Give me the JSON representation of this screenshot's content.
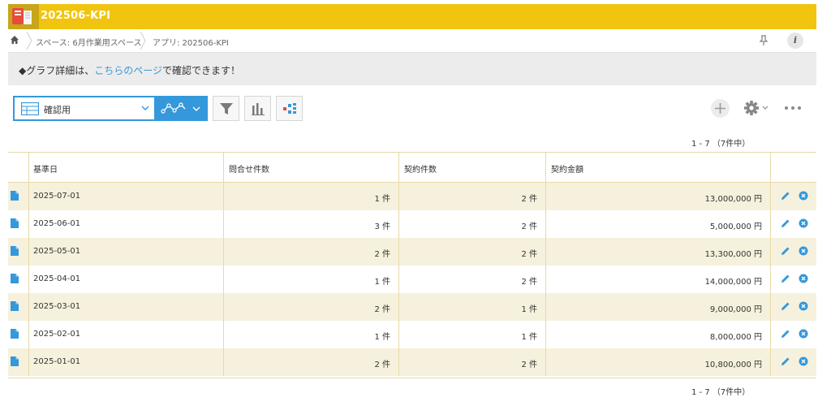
{
  "app": {
    "title": "202506-KPI"
  },
  "breadcrumb": {
    "space": "スペース: 6月作業用スペース",
    "app": "アプリ: 202506-KPI"
  },
  "notice": {
    "prefix": "◆グラフ詳細は、",
    "link": "こちらのページ",
    "suffix": "で確認できます！"
  },
  "toolbar": {
    "view_label": "確認用"
  },
  "pager": {
    "range": "1 - 7 （7件中）"
  },
  "table": {
    "headers": [
      "基準日",
      "問合せ件数",
      "契約件数",
      "契約金額"
    ],
    "rows": [
      [
        "2025-07-01",
        "1 件",
        "2 件",
        "13,000,000 円"
      ],
      [
        "2025-06-01",
        "3 件",
        "2 件",
        "5,000,000 円"
      ],
      [
        "2025-05-01",
        "2 件",
        "2 件",
        "13,300,000 円"
      ],
      [
        "2025-04-01",
        "1 件",
        "2 件",
        "14,000,000 円"
      ],
      [
        "2025-03-01",
        "2 件",
        "1 件",
        "9,000,000 円"
      ],
      [
        "2025-02-01",
        "1 件",
        "1 件",
        "8,000,000 円"
      ],
      [
        "2025-01-01",
        "2 件",
        "2 件",
        "10,800,000 円"
      ]
    ]
  },
  "colors": {
    "header_bar": "#f1c40f",
    "accent": "#3498db",
    "row_stripe": "#f6f1dd",
    "grid_border": "#e8d9a6"
  },
  "icons": {
    "app": "app-book-icon",
    "home": "home-icon",
    "pin": "pin-icon",
    "info": "info-icon",
    "view": "table-view-icon",
    "graph": "line-graph-icon",
    "filter": "funnel-icon",
    "chart": "bar-chart-icon",
    "process": "process-icon",
    "add": "plus-icon",
    "settings": "gear-icon",
    "more": "ellipsis-icon",
    "record": "document-icon",
    "edit": "pencil-icon",
    "delete": "delete-icon"
  }
}
